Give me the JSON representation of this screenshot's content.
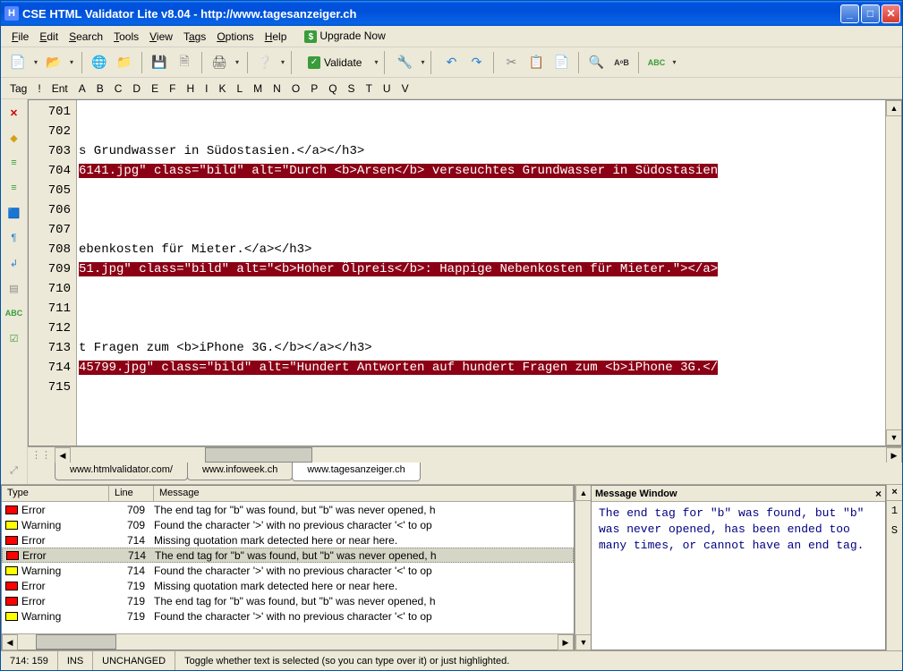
{
  "title": "CSE HTML Validator Lite v8.04 - http://www.tagesanzeiger.ch",
  "menu": {
    "file": "File",
    "edit": "Edit",
    "search": "Search",
    "tools": "Tools",
    "view": "View",
    "tags": "Tags",
    "options": "Options",
    "help": "Help",
    "upgrade": "Upgrade Now"
  },
  "toolbar": {
    "validate": "Validate"
  },
  "tagbar": [
    "Tag",
    "!",
    "Ent",
    "A",
    "B",
    "C",
    "D",
    "E",
    "F",
    "H",
    "I",
    "K",
    "L",
    "M",
    "N",
    "O",
    "P",
    "Q",
    "S",
    "T",
    "U",
    "V"
  ],
  "lines": {
    "l701": "",
    "l702": "",
    "l703": "s Grundwasser in Südostasien.</a></h3>",
    "l704": "6141.jpg\" class=\"bild\" alt=\"Durch <b>Arsen</b> verseuchtes Grundwasser in Südostasien",
    "l705": "",
    "l706": "",
    "l707": "",
    "l708": "ebenkosten für Mieter.</a></h3>",
    "l709": "51.jpg\" class=\"bild\" alt=\"<b>Hoher Ölpreis</b>: Happige Nebenkosten für Mieter.\"></a>",
    "l710": "",
    "l711": "",
    "l712": "",
    "l713": "t Fragen zum <b>iPhone 3G.</b></a></h3>",
    "l714": "45799.jpg\" class=\"bild\" alt=\"Hundert Antworten auf hundert Fragen zum <b>iPhone 3G.</",
    "l715": ""
  },
  "line_numbers": [
    "701",
    "702",
    "703",
    "704",
    "705",
    "706",
    "707",
    "708",
    "709",
    "710",
    "711",
    "712",
    "713",
    "714",
    "715"
  ],
  "tabs": {
    "t1": "www.htmlvalidator.com/",
    "t2": "www.infoweek.ch",
    "t3": "www.tagesanzeiger.ch"
  },
  "msg_headers": {
    "type": "Type",
    "line": "Line",
    "msg": "Message"
  },
  "messages": [
    {
      "type": "Error",
      "badge": "err",
      "line": "709",
      "text": "The end tag for \"b\" was found, but \"b\" was never opened, h"
    },
    {
      "type": "Warning",
      "badge": "warn",
      "line": "709",
      "text": "Found the character '>' with no previous character '<' to op"
    },
    {
      "type": "Error",
      "badge": "err",
      "line": "714",
      "text": "Missing quotation mark detected here or near here."
    },
    {
      "type": "Error",
      "badge": "err",
      "line": "714",
      "text": "The end tag for \"b\" was found, but \"b\" was never opened, h",
      "sel": true
    },
    {
      "type": "Warning",
      "badge": "warn",
      "line": "714",
      "text": "Found the character '>' with no previous character '<' to op"
    },
    {
      "type": "Error",
      "badge": "err",
      "line": "719",
      "text": "Missing quotation mark detected here or near here."
    },
    {
      "type": "Error",
      "badge": "err",
      "line": "719",
      "text": "The end tag for \"b\" was found, but \"b\" was never opened, h"
    },
    {
      "type": "Warning",
      "badge": "warn",
      "line": "719",
      "text": "Found the character '>' with no previous character '<' to op"
    }
  ],
  "message_window": {
    "title": "Message Window",
    "body": "The end tag for \"b\" was found, but \"b\" was never opened, has been ended too many times, or cannot have an end tag."
  },
  "right_tabs": {
    "t1": "1",
    "t2": "S"
  },
  "status": {
    "pos": "714: 159",
    "ins": "INS",
    "changed": "UNCHANGED",
    "help": "Toggle whether text is selected (so you can type over it) or just highlighted."
  }
}
